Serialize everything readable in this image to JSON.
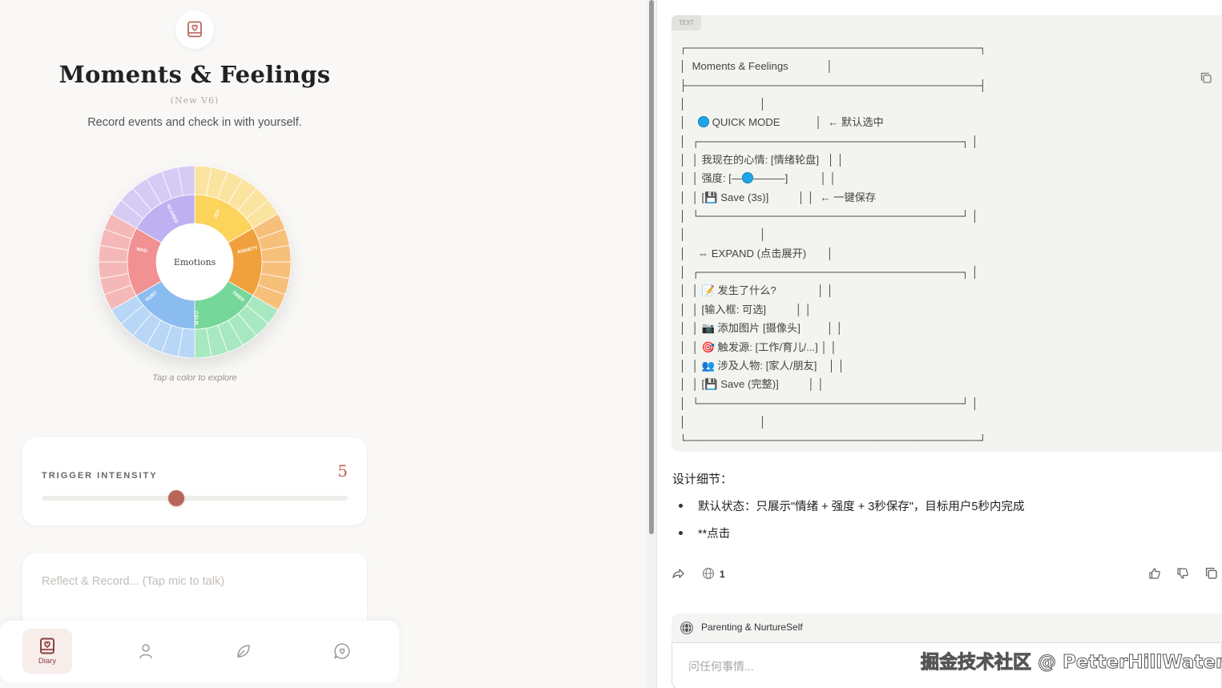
{
  "app": {
    "title": "Moments & Feelings",
    "version": "(New V6)",
    "subtitle": "Record events and check in with yourself.",
    "wheel": {
      "center_label": "Emotions",
      "hint": "Tap a color to explore",
      "inner_labels": [
        "JOY",
        "ANXIETY",
        "TIRED",
        "CALM",
        "HURT",
        "MAD",
        "SCARED"
      ],
      "colors": {
        "outer": [
          "#fbe3a0",
          "#f6bf7a",
          "#a8e8c0",
          "#b8d6f5",
          "#f5b8b8",
          "#d6cbf5"
        ],
        "inner": [
          "#fcd45c",
          "#f0a03c",
          "#76d79a",
          "#8bbcf0",
          "#f29191",
          "#bfb0f2"
        ]
      }
    },
    "intensity": {
      "label": "TRIGGER INTENSITY",
      "value": "5",
      "fraction": 0.44
    },
    "note": {
      "placeholder": "Reflect & Record... (Tap mic to talk)"
    },
    "nav": [
      {
        "label": "Diary",
        "icon": "diary-icon",
        "active": true
      },
      {
        "label": "",
        "icon": "profile-icon",
        "active": false
      },
      {
        "label": "",
        "icon": "leaf-icon",
        "active": false
      },
      {
        "label": "",
        "icon": "chat-heart-icon",
        "active": false
      }
    ],
    "accent": "#b9655a"
  },
  "chat": {
    "code_lang": "TEXT",
    "code_lines": [
      "┌───────────────────────────────────────┐",
      "│  Moments & Feelings             │",
      "├───────────────────────────────────────┤",
      "│                         │",
      "│    ● QUICK MODE            │  ← 默认选中",
      "│  ┌───────────────────────────────────┐ │",
      "│  │ 我现在的心情: [情绪轮盘]   │ │",
      "│  │ 强度: [—●———]           │ │",
      "│  │ [💾 Save (3s)]          │ │  ← 一键保存",
      "│  └───────────────────────────────────┘ │",
      "│                         │",
      "│    ⇔ EXPAND (点击展开)       │",
      "│  ┌───────────────────────────────────┐ │",
      "│  │ 📝 发生了什么?              │ │",
      "│  │ [输入框: 可选]          │ │",
      "│  │ 📷 添加图片 [摄像头]         │ │",
      "│  │ 🎯 触发源: [工作/育儿/...] │ │",
      "│  │ 👥 涉及人物: [家人/朋友]    │ │",
      "│  │ [💾 Save (完整)]          │ │",
      "│  └───────────────────────────────────┘ │",
      "│                         │",
      "└───────────────────────────────────────┘"
    ],
    "heading": "设计细节：",
    "bullets": [
      "默认状态：只展示\"情绪 + 强度 + 3秒保存\"，目标用户5秒内完成",
      "**点击"
    ],
    "sources_count": "1",
    "composer": {
      "context": "Parenting & NurtureSelf",
      "placeholder": "问任何事情..."
    },
    "watermark": "掘金技术社区 @ PetterHillWater"
  }
}
